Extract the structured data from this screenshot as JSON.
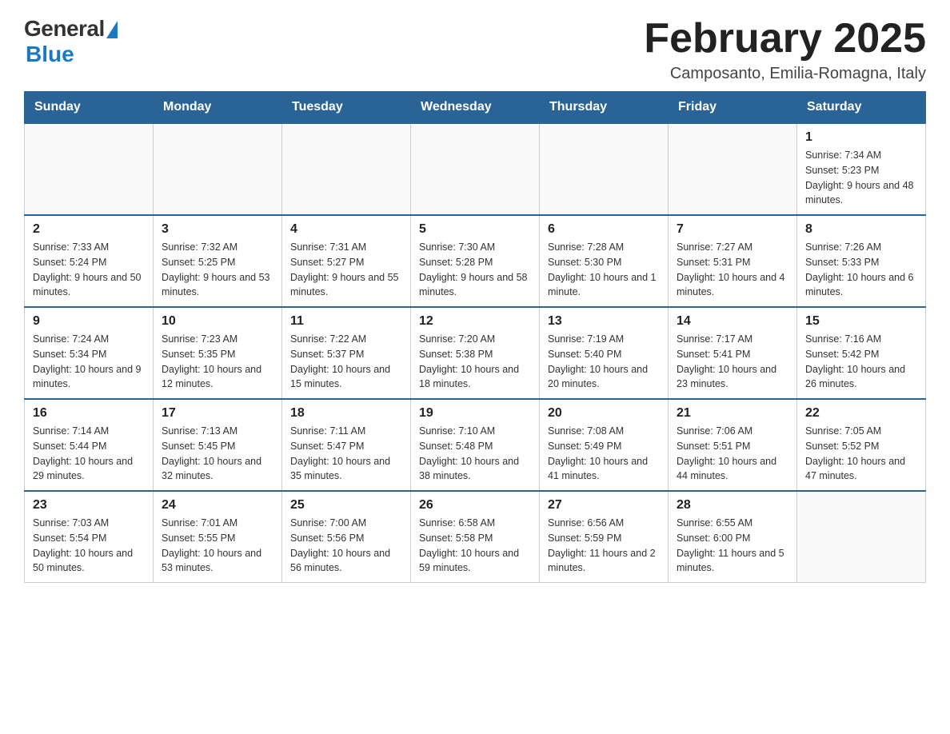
{
  "header": {
    "logo_general": "General",
    "logo_blue": "Blue",
    "title": "February 2025",
    "location": "Camposanto, Emilia-Romagna, Italy"
  },
  "days_of_week": [
    "Sunday",
    "Monday",
    "Tuesday",
    "Wednesday",
    "Thursday",
    "Friday",
    "Saturday"
  ],
  "weeks": [
    [
      {
        "day": "",
        "info": ""
      },
      {
        "day": "",
        "info": ""
      },
      {
        "day": "",
        "info": ""
      },
      {
        "day": "",
        "info": ""
      },
      {
        "day": "",
        "info": ""
      },
      {
        "day": "",
        "info": ""
      },
      {
        "day": "1",
        "info": "Sunrise: 7:34 AM\nSunset: 5:23 PM\nDaylight: 9 hours and 48 minutes."
      }
    ],
    [
      {
        "day": "2",
        "info": "Sunrise: 7:33 AM\nSunset: 5:24 PM\nDaylight: 9 hours and 50 minutes."
      },
      {
        "day": "3",
        "info": "Sunrise: 7:32 AM\nSunset: 5:25 PM\nDaylight: 9 hours and 53 minutes."
      },
      {
        "day": "4",
        "info": "Sunrise: 7:31 AM\nSunset: 5:27 PM\nDaylight: 9 hours and 55 minutes."
      },
      {
        "day": "5",
        "info": "Sunrise: 7:30 AM\nSunset: 5:28 PM\nDaylight: 9 hours and 58 minutes."
      },
      {
        "day": "6",
        "info": "Sunrise: 7:28 AM\nSunset: 5:30 PM\nDaylight: 10 hours and 1 minute."
      },
      {
        "day": "7",
        "info": "Sunrise: 7:27 AM\nSunset: 5:31 PM\nDaylight: 10 hours and 4 minutes."
      },
      {
        "day": "8",
        "info": "Sunrise: 7:26 AM\nSunset: 5:33 PM\nDaylight: 10 hours and 6 minutes."
      }
    ],
    [
      {
        "day": "9",
        "info": "Sunrise: 7:24 AM\nSunset: 5:34 PM\nDaylight: 10 hours and 9 minutes."
      },
      {
        "day": "10",
        "info": "Sunrise: 7:23 AM\nSunset: 5:35 PM\nDaylight: 10 hours and 12 minutes."
      },
      {
        "day": "11",
        "info": "Sunrise: 7:22 AM\nSunset: 5:37 PM\nDaylight: 10 hours and 15 minutes."
      },
      {
        "day": "12",
        "info": "Sunrise: 7:20 AM\nSunset: 5:38 PM\nDaylight: 10 hours and 18 minutes."
      },
      {
        "day": "13",
        "info": "Sunrise: 7:19 AM\nSunset: 5:40 PM\nDaylight: 10 hours and 20 minutes."
      },
      {
        "day": "14",
        "info": "Sunrise: 7:17 AM\nSunset: 5:41 PM\nDaylight: 10 hours and 23 minutes."
      },
      {
        "day": "15",
        "info": "Sunrise: 7:16 AM\nSunset: 5:42 PM\nDaylight: 10 hours and 26 minutes."
      }
    ],
    [
      {
        "day": "16",
        "info": "Sunrise: 7:14 AM\nSunset: 5:44 PM\nDaylight: 10 hours and 29 minutes."
      },
      {
        "day": "17",
        "info": "Sunrise: 7:13 AM\nSunset: 5:45 PM\nDaylight: 10 hours and 32 minutes."
      },
      {
        "day": "18",
        "info": "Sunrise: 7:11 AM\nSunset: 5:47 PM\nDaylight: 10 hours and 35 minutes."
      },
      {
        "day": "19",
        "info": "Sunrise: 7:10 AM\nSunset: 5:48 PM\nDaylight: 10 hours and 38 minutes."
      },
      {
        "day": "20",
        "info": "Sunrise: 7:08 AM\nSunset: 5:49 PM\nDaylight: 10 hours and 41 minutes."
      },
      {
        "day": "21",
        "info": "Sunrise: 7:06 AM\nSunset: 5:51 PM\nDaylight: 10 hours and 44 minutes."
      },
      {
        "day": "22",
        "info": "Sunrise: 7:05 AM\nSunset: 5:52 PM\nDaylight: 10 hours and 47 minutes."
      }
    ],
    [
      {
        "day": "23",
        "info": "Sunrise: 7:03 AM\nSunset: 5:54 PM\nDaylight: 10 hours and 50 minutes."
      },
      {
        "day": "24",
        "info": "Sunrise: 7:01 AM\nSunset: 5:55 PM\nDaylight: 10 hours and 53 minutes."
      },
      {
        "day": "25",
        "info": "Sunrise: 7:00 AM\nSunset: 5:56 PM\nDaylight: 10 hours and 56 minutes."
      },
      {
        "day": "26",
        "info": "Sunrise: 6:58 AM\nSunset: 5:58 PM\nDaylight: 10 hours and 59 minutes."
      },
      {
        "day": "27",
        "info": "Sunrise: 6:56 AM\nSunset: 5:59 PM\nDaylight: 11 hours and 2 minutes."
      },
      {
        "day": "28",
        "info": "Sunrise: 6:55 AM\nSunset: 6:00 PM\nDaylight: 11 hours and 5 minutes."
      },
      {
        "day": "",
        "info": ""
      }
    ]
  ]
}
